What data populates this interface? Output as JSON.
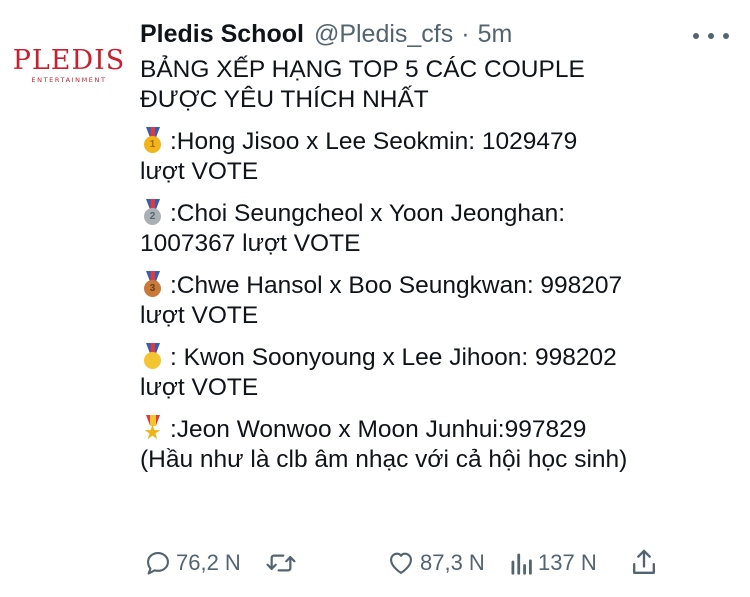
{
  "author": {
    "display_name": "Pledis School",
    "handle": "@Pledis_cfs",
    "separator": "·",
    "time": "5m",
    "avatar": {
      "logo_word": "PLEDIS",
      "logo_sub": "ENTERTAINMENT"
    }
  },
  "tweet": {
    "title_lines": [
      "BẢNG XẾP HẠNG TOP 5 CÁC COUPLE",
      "ĐƯỢC YÊU THÍCH NHẤT"
    ],
    "entries": [
      {
        "medal": "1st-place-medal-icon",
        "line1": ":Hong Jisoo x Lee Seokmin: 1029479",
        "line2": "lượt VOTE"
      },
      {
        "medal": "2nd-place-medal-icon",
        "line1": ":Choi Seungcheol x Yoon Jeonghan:",
        "line2": "1007367 lượt VOTE"
      },
      {
        "medal": "3rd-place-medal-icon",
        "line1": ":Chwe Hansol x Boo Seungkwan: 998207",
        "line2": "lượt VOTE"
      },
      {
        "medal": "sports-medal-icon",
        "line1": ": Kwon Soonyoung x Lee Jihoon: 998202",
        "line2": "lượt VOTE"
      },
      {
        "medal": "military-medal-icon",
        "line1": ":Jeon Wonwoo x Moon Junhui:997829",
        "line2": "(Hầu như là clb âm nhạc với cả hội học sinh)"
      }
    ]
  },
  "actions": {
    "reply": {
      "icon": "reply-icon",
      "count": "76,2 N"
    },
    "retweet": {
      "icon": "retweet-icon",
      "count": ""
    },
    "like": {
      "icon": "heart-icon",
      "count": "87,3 N"
    },
    "views": {
      "icon": "views-icon",
      "count": "137 N"
    },
    "share": {
      "icon": "share-icon"
    }
  },
  "colors": {
    "text": "#0f1419",
    "secondary": "#536471",
    "logo": "#c8202f"
  }
}
